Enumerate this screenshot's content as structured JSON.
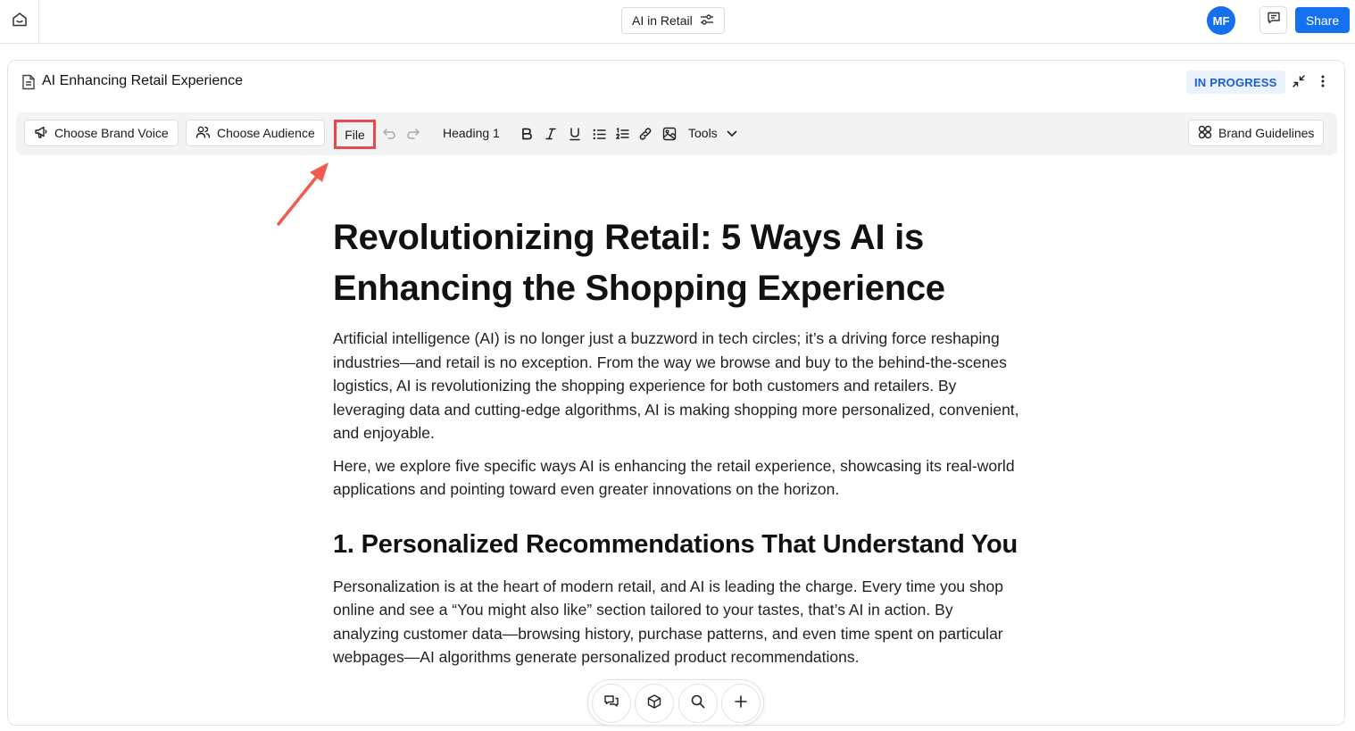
{
  "topbar": {
    "home_icon": "home-icon",
    "project_name": "AI in Retail",
    "project_settings_icon": "sliders-icon",
    "avatar_initials": "MF",
    "comments_icon": "comment-icon",
    "share_label": "Share"
  },
  "document": {
    "title": "AI Enhancing Retail Experience",
    "status": "IN PROGRESS"
  },
  "toolbar": {
    "brand_voice_label": "Choose Brand Voice",
    "audience_label": "Choose Audience",
    "file_label": "File",
    "heading_label": "Heading 1",
    "tools_label": "Tools",
    "brand_guidelines_label": "Brand Guidelines"
  },
  "article": {
    "title": "Revolutionizing Retail: 5 Ways AI is Enhancing the Shopping Experience",
    "intro_p1": "Artificial intelligence (AI) is no longer just a buzzword in tech circles; it’s a driving force reshaping industries—and retail is no exception. From the way we browse and buy to the behind-the-scenes logistics, AI is revolutionizing the shopping experience for both customers and retailers. By leveraging data and cutting-edge algorithms, AI is making shopping more personalized, convenient, and enjoyable.",
    "intro_p2": "Here, we explore five specific ways AI is enhancing the retail experience, showcasing its real-world applications and pointing toward even greater innovations on the horizon.",
    "section1_heading": "1. Personalized Recommendations That Understand You",
    "section1_p1": "Personalization is at the heart of modern retail, and AI is leading the charge. Every time you shop online and see a “You might also like” section tailored to your tastes, that’s AI in action. By analyzing customer data—browsing history, purchase patterns, and even time spent on particular webpages—AI algorithms generate personalized product recommendations."
  },
  "colors": {
    "accent": "#1570ef",
    "highlight": "#e5484d",
    "status_bg": "#eaf2fe",
    "status_text": "#1a5fd6"
  }
}
